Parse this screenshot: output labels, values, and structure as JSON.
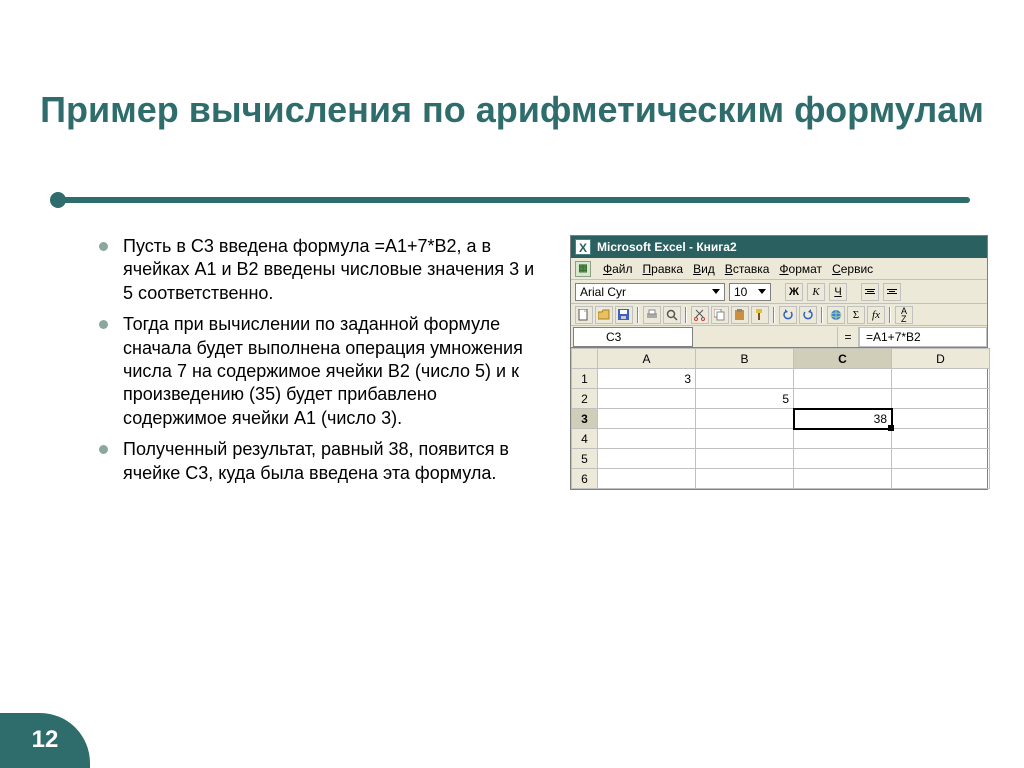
{
  "slide": {
    "title": "Пример вычисления по арифметическим формулам",
    "bullets": [
      "Пусть в С3 введена формула =А1+7*В2, а в ячейках А1 и В2 введены числовые значения 3 и 5 соответственно.",
      "Тогда при вычислении по заданной формуле сначала будет выполнена операция умножения числа 7 на содержимое ячейки В2 (число 5) и к произведению (35) будет прибавлено содержимое ячейки А1 (число 3).",
      "Полученный результат, равный 38, появится в ячейке С3, куда была введена эта формула."
    ],
    "page_number": "12"
  },
  "excel": {
    "title": "Microsoft Excel - Книга2",
    "menu": [
      "Файл",
      "Правка",
      "Вид",
      "Вставка",
      "Формат",
      "Сервис"
    ],
    "font_name": "Arial Cyr",
    "font_size": "10",
    "style_buttons": {
      "bold": "Ж",
      "italic": "К",
      "underline": "Ч"
    },
    "name_box": "C3",
    "eq_label": "=",
    "formula": "=A1+7*B2",
    "columns": [
      "A",
      "B",
      "C",
      "D"
    ],
    "rows": [
      "1",
      "2",
      "3",
      "4",
      "5",
      "6"
    ],
    "active": {
      "col": "C",
      "row": "3"
    },
    "cells": {
      "A1": "3",
      "B2": "5",
      "C3": "38"
    }
  }
}
